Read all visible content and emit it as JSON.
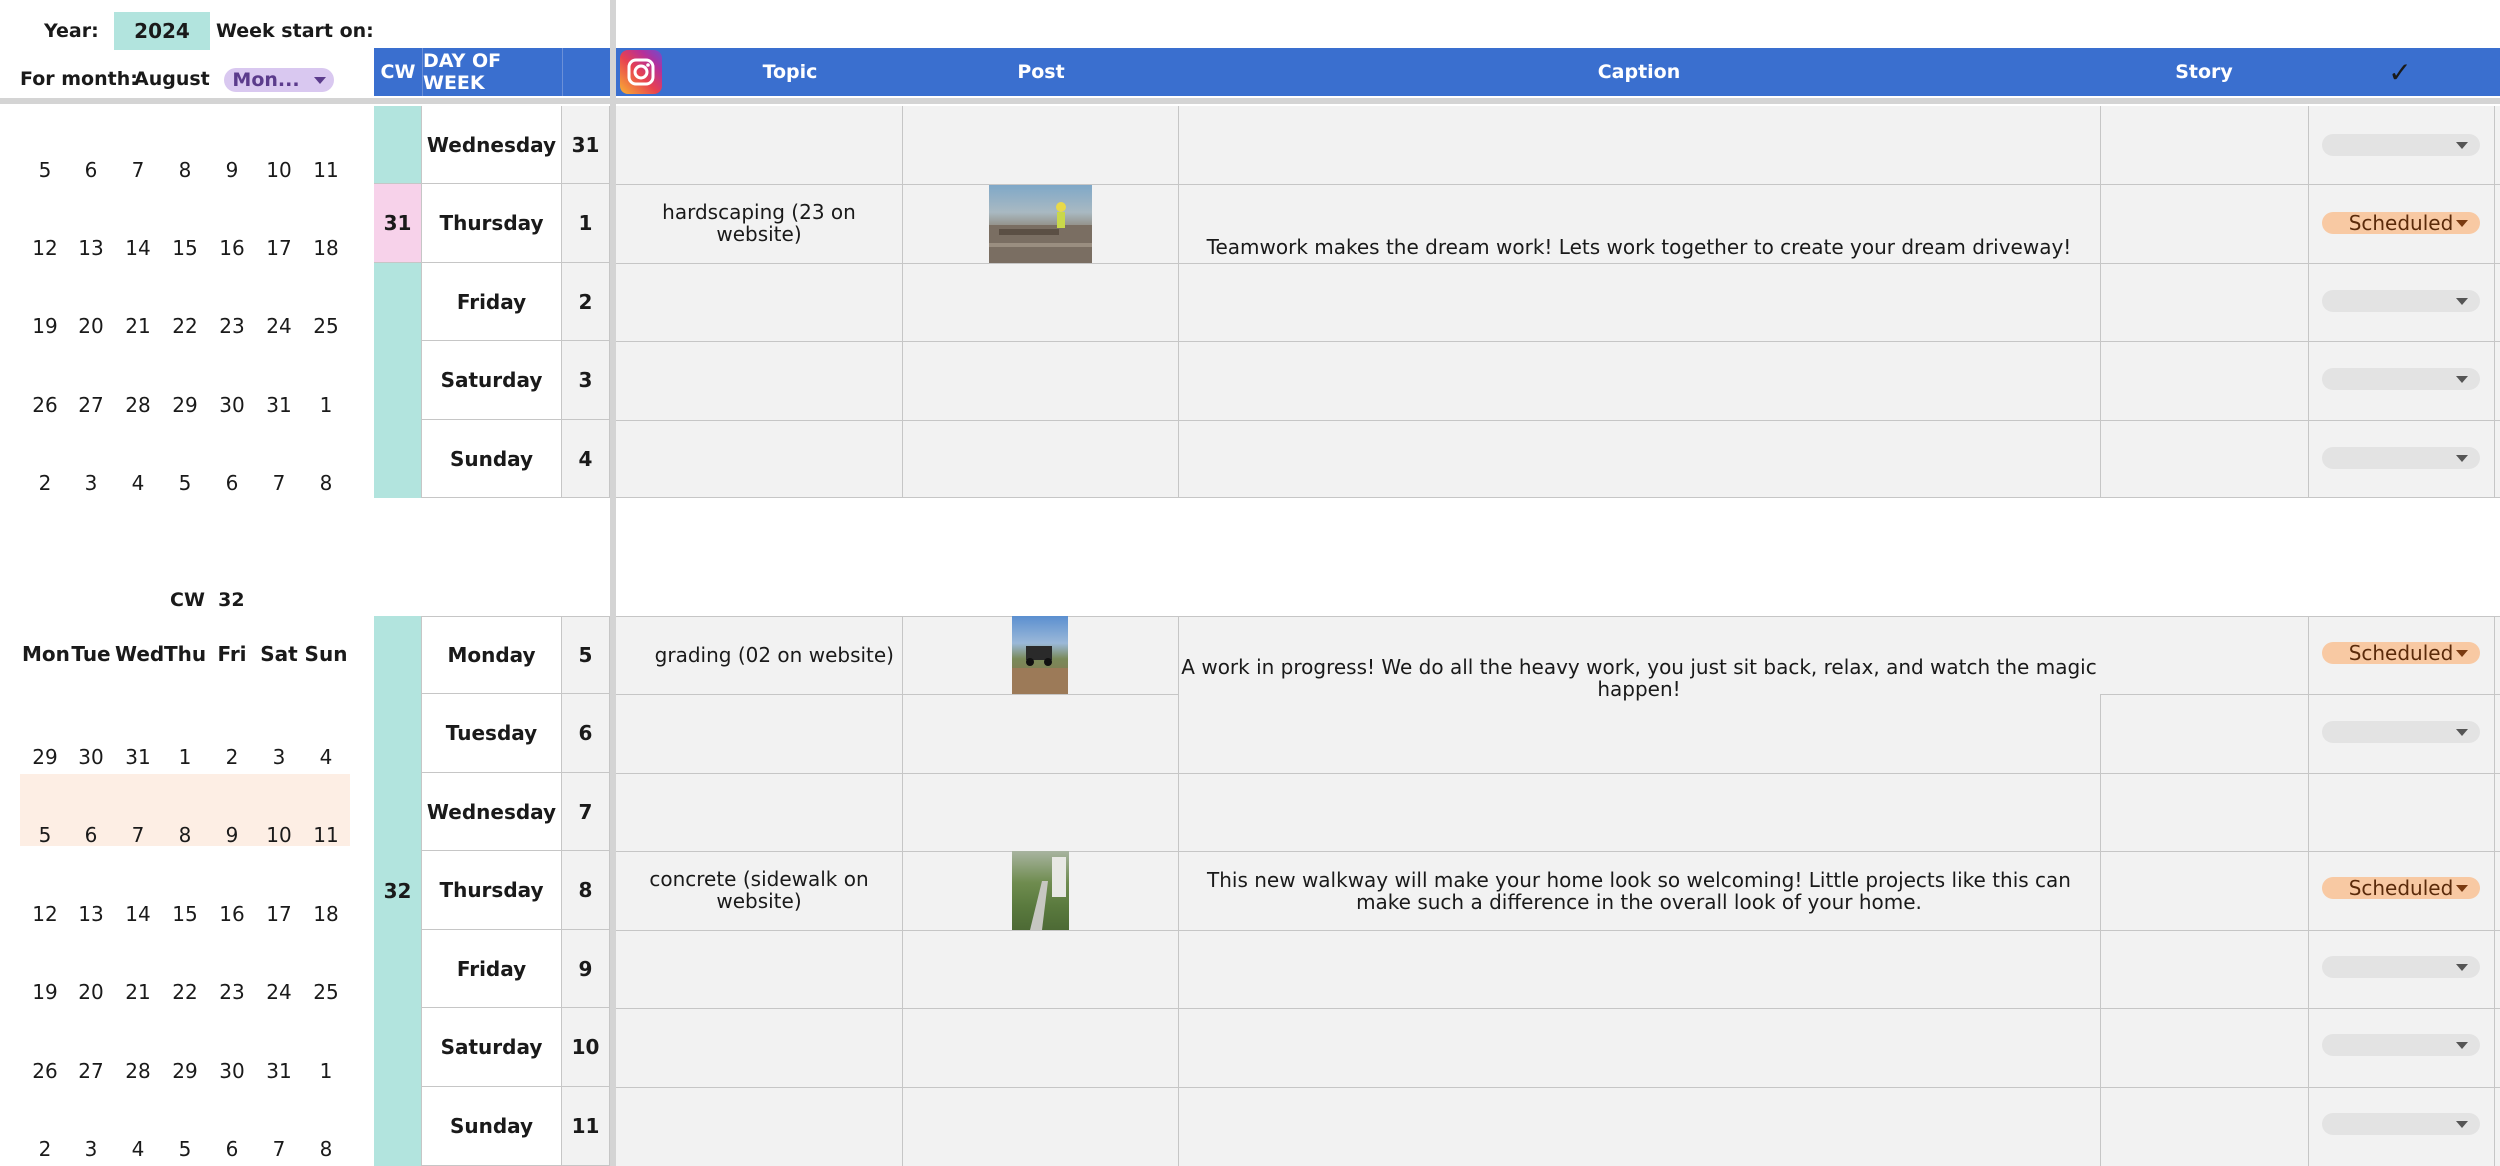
{
  "settings": {
    "year_label": "Year:",
    "year_value": "2024",
    "week_start_label": "Week start on:",
    "month_label": "For month:",
    "month_value": "August",
    "week_start_value": "Mon..."
  },
  "header": {
    "cw": "CW",
    "day_of_week": "DAY OF WEEK",
    "topic": "Topic",
    "post": "Post",
    "caption": "Caption",
    "story": "Story",
    "check": "✓"
  },
  "calendar_top": {
    "rows": [
      [
        "5",
        "6",
        "7",
        "8",
        "9",
        "10",
        "11"
      ],
      [
        "12",
        "13",
        "14",
        "15",
        "16",
        "17",
        "18"
      ],
      [
        "19",
        "20",
        "21",
        "22",
        "23",
        "24",
        "25"
      ],
      [
        "26",
        "27",
        "28",
        "29",
        "30",
        "31",
        "1"
      ],
      [
        "2",
        "3",
        "4",
        "5",
        "6",
        "7",
        "8"
      ]
    ]
  },
  "calendar_week32": {
    "title": "CW  32",
    "dow": [
      "Mon",
      "Tue",
      "Wed",
      "Thu",
      "Fri",
      "Sat",
      "Sun"
    ],
    "rows": [
      [
        "29",
        "30",
        "31",
        "1",
        "2",
        "3",
        "4"
      ],
      [
        "5",
        "6",
        "7",
        "8",
        "9",
        "10",
        "11"
      ],
      [
        "12",
        "13",
        "14",
        "15",
        "16",
        "17",
        "18"
      ],
      [
        "19",
        "20",
        "21",
        "22",
        "23",
        "24",
        "25"
      ],
      [
        "26",
        "27",
        "28",
        "29",
        "30",
        "31",
        "1"
      ],
      [
        "2",
        "3",
        "4",
        "5",
        "6",
        "7",
        "8"
      ]
    ]
  },
  "week31": {
    "cw": "31",
    "rows": [
      {
        "day": "Wednesday",
        "date": "31",
        "topic": "",
        "caption": "",
        "status": ""
      },
      {
        "day": "Thursday",
        "date": "1",
        "topic": "hardscaping (23 on website)",
        "caption": "Teamwork makes the dream work! Lets work together to create your dream driveway!",
        "status": "Scheduled"
      },
      {
        "day": "Friday",
        "date": "2",
        "topic": "",
        "caption": "",
        "status": ""
      },
      {
        "day": "Saturday",
        "date": "3",
        "topic": "",
        "caption": "",
        "status": ""
      },
      {
        "day": "Sunday",
        "date": "4",
        "topic": "",
        "caption": "",
        "status": ""
      }
    ]
  },
  "week32": {
    "cw": "32",
    "rows": [
      {
        "day": "Monday",
        "date": "5",
        "topic": "grading (02 on website)",
        "caption": "A work in progress! We do all the heavy work, you just sit back, relax, and watch the magic happen!",
        "status": "Scheduled"
      },
      {
        "day": "Tuesday",
        "date": "6",
        "topic": "",
        "caption": "",
        "status": ""
      },
      {
        "day": "Wednesday",
        "date": "7",
        "topic": "",
        "caption": "",
        "status": ""
      },
      {
        "day": "Thursday",
        "date": "8",
        "topic": "concrete (sidewalk on website)",
        "caption": "This new walkway will make your home look so welcoming! Little projects like this can make such a difference in the overall look of your home.",
        "status": "Scheduled"
      },
      {
        "day": "Friday",
        "date": "9",
        "topic": "",
        "caption": "",
        "status": ""
      },
      {
        "day": "Saturday",
        "date": "10",
        "topic": "",
        "caption": "",
        "status": ""
      },
      {
        "day": "Sunday",
        "date": "11",
        "topic": "",
        "caption": "",
        "status": ""
      }
    ]
  },
  "icons": {
    "instagram": "instagram-icon",
    "dropdown": "chevron-down-icon"
  },
  "colors": {
    "header_blue": "#3a6fcf",
    "teal": "#b2e4de",
    "pink": "#f7d2ea",
    "scheduled": "#f8c9a3",
    "highlight_week": "#fdeee4",
    "lavender": "#d9c8f0"
  }
}
